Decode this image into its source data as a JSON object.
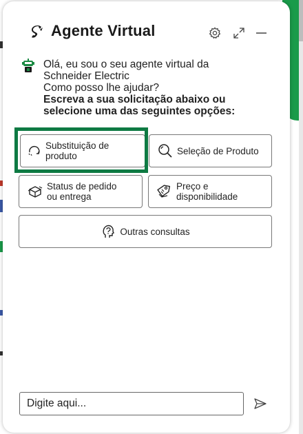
{
  "widget": {
    "title": "Agente Virtual",
    "accent_color": "#0e7a43",
    "icons": {
      "logo": "schneider-logo-icon",
      "settings": "gear-icon",
      "expand": "expand-icon",
      "minimize": "minimize-icon",
      "bot": "bot-avatar-icon",
      "send": "send-icon"
    }
  },
  "message": {
    "line1": "Olá, eu sou o seu agente virtual da",
    "line2": "Schneider Electric",
    "line3": "Como posso lhe ajudar?",
    "bold1": "Escreva a sua solicitação abaixo ou",
    "bold2": "selecione uma das seguintes opções:"
  },
  "options": [
    {
      "line1": "Substituição de",
      "line2": "produto",
      "icon": "refresh-icon",
      "focused": true
    },
    {
      "label": "Seleção de Produto",
      "icon": "search-icon"
    },
    {
      "line1": "Status de pedido",
      "line2": "ou entrega",
      "icon": "package-icon"
    },
    {
      "line1": "Preço e",
      "line2": "disponibilidade",
      "icon": "price-tag-icon"
    },
    {
      "label": "Outras consultas",
      "icon": "question-head-icon"
    }
  ],
  "composer": {
    "placeholder": "Digite aqui..."
  }
}
